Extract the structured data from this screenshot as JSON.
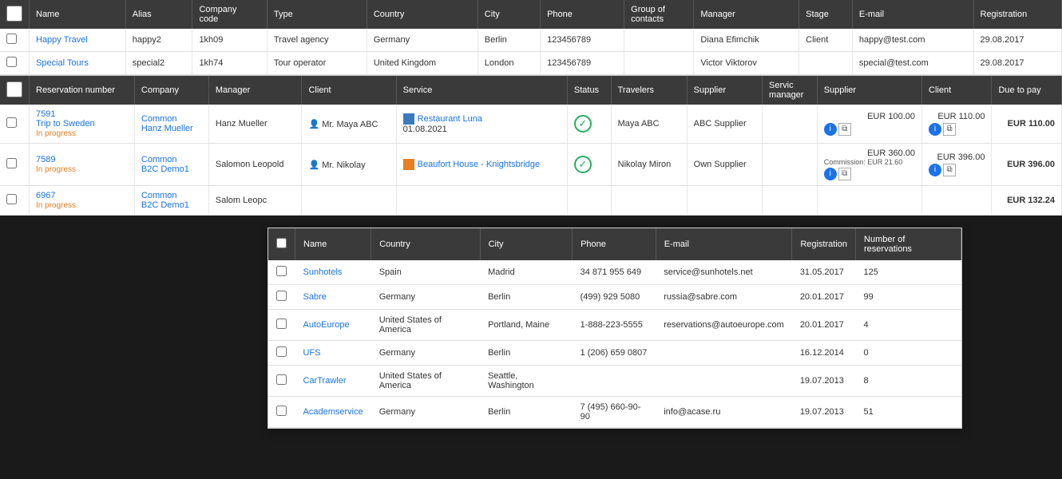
{
  "topTable": {
    "columns": [
      "",
      "Name",
      "Alias",
      "Company code",
      "Type",
      "Country",
      "City",
      "Phone",
      "Group of contacts",
      "Manager",
      "Stage",
      "E-mail",
      "Registration"
    ],
    "rows": [
      {
        "id": "row-happy-travel",
        "name": "Happy Travel",
        "alias": "happy2",
        "code": "1kh09",
        "type": "Travel agency",
        "country": "Germany",
        "city": "Berlin",
        "phone": "123456789",
        "group": "",
        "manager": "Diana Efimchik",
        "stage": "Client",
        "email": "happy@test.com",
        "registration": "29.08.2017"
      },
      {
        "id": "row-special-tours",
        "name": "Special Tours",
        "alias": "special2",
        "code": "1kh74",
        "type": "Tour operator",
        "country": "United Kingdom",
        "city": "London",
        "phone": "123456789",
        "group": "",
        "manager": "Victor Viktorov",
        "stage": "",
        "email": "special@test.com",
        "registration": "29.08.2017"
      }
    ]
  },
  "reservationsTable": {
    "columns": [
      "",
      "Reservation number",
      "Company",
      "Manager",
      "Client",
      "Service",
      "Status",
      "Travelers",
      "Supplier",
      "Servic manager",
      "Supplier",
      "Client",
      "Due to pay"
    ],
    "rows": [
      {
        "id": "res-7591",
        "number": "7591",
        "trip": "Trip to Sweden",
        "status_label": "In progress",
        "company": "Common",
        "company_sub": "Hanz Mueller",
        "manager": "Hanz Mueller",
        "client_icon": "person",
        "client": "Mr. Maya ABC",
        "service_type": "restaurant",
        "service": "Restaurant Luna",
        "service_date": "01.08.2021",
        "travelers": "Maya ABC",
        "supplier": "ABC Supplier",
        "service_manager": "",
        "supplier_amt": "EUR 100.00",
        "client_amt": "EUR 110.00",
        "due_pay": "EUR 110.00"
      },
      {
        "id": "res-7589",
        "number": "7589",
        "trip": "",
        "status_label": "In progress",
        "company": "Common",
        "company_sub": "B2C Demo1",
        "manager": "Salomon Leopold",
        "client_icon": "person",
        "client": "Mr. Nikolay",
        "service_type": "hotel",
        "service": "Beaufort House - Knightsbridge",
        "service_date": "",
        "travelers": "Nikolay Miron",
        "supplier": "Own Supplier",
        "service_manager": "",
        "supplier_amt": "EUR 360.00",
        "commission": "Commission: EUR 21.60",
        "client_amt": "EUR 396.00",
        "due_pay": "EUR 396.00"
      },
      {
        "id": "res-6967",
        "number": "6967",
        "trip": "",
        "status_label": "In progress",
        "company": "Common",
        "company_sub": "B2C Demo1",
        "manager": "Salom Leopc",
        "client_icon": "person",
        "client": "",
        "service_type": "",
        "service": "",
        "service_date": "",
        "travelers": "",
        "supplier": "",
        "service_manager": "",
        "supplier_amt": "",
        "commission": "",
        "client_amt": "",
        "due_pay": "EUR 132.24"
      }
    ]
  },
  "supplierDropdown": {
    "columns": [
      "",
      "Name",
      "Country",
      "City",
      "Phone",
      "E-mail",
      "Registration",
      "Number of reservations"
    ],
    "rows": [
      {
        "name": "Sunhotels",
        "country": "Spain",
        "city": "Madrid",
        "phone": "34 871 955 649",
        "email": "service@sunhotels.net",
        "registration": "31.05.2017",
        "reservations": "125"
      },
      {
        "name": "Sabre",
        "country": "Germany",
        "city": "Berlin",
        "phone": "(499) 929 5080",
        "email": "russia@sabre.com",
        "registration": "20.01.2017",
        "reservations": "99"
      },
      {
        "name": "AutoEurope",
        "country": "United States of America",
        "city": "Portland, Maine",
        "phone": "1-888-223-5555",
        "email": "reservations@autoeurope.com",
        "registration": "20.01.2017",
        "reservations": "4"
      },
      {
        "name": "UFS",
        "country": "Germany",
        "city": "Berlin",
        "phone": "1 (206) 659 0807",
        "email": "",
        "registration": "16.12.2014",
        "reservations": "0"
      },
      {
        "name": "CarTrawler",
        "country": "United States of America",
        "city": "Seattle, Washington",
        "phone": "",
        "email": "",
        "registration": "19.07.2013",
        "reservations": "8"
      },
      {
        "name": "Academservice",
        "country": "Germany",
        "city": "Berlin",
        "phone": "7 (495) 660-90-90",
        "email": "info@acase.ru",
        "registration": "19.07.2013",
        "reservations": "51"
      }
    ]
  },
  "labels": {
    "in_progress": "In progress",
    "common": "Common"
  }
}
